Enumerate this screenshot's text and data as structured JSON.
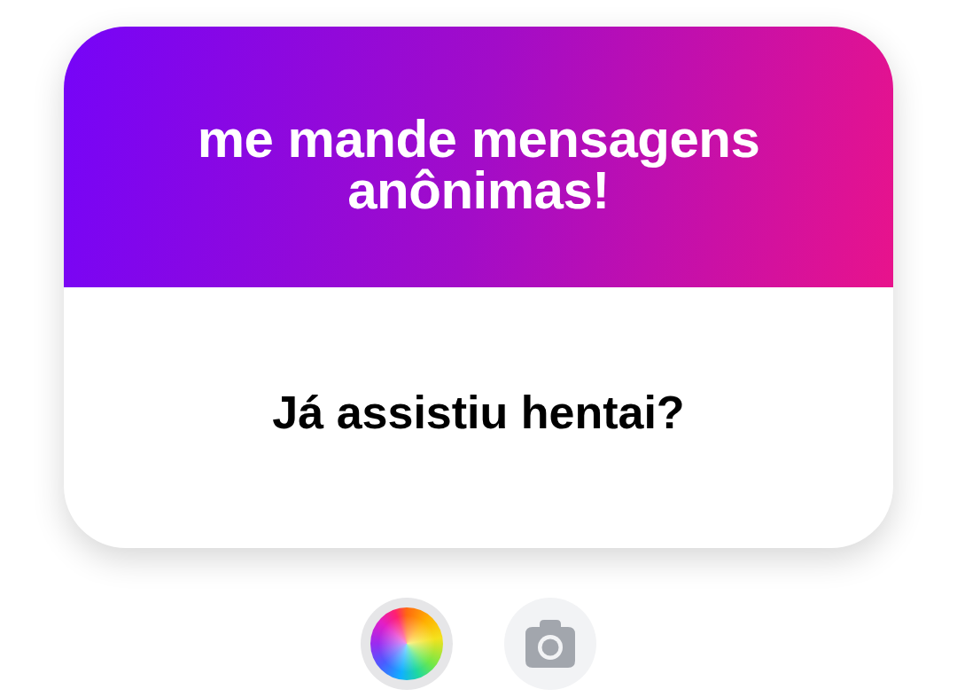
{
  "card": {
    "header": "me mande mensagens anônimas!",
    "question": "Já assistiu hentai?"
  },
  "options": [
    {
      "kind": "color_wheel",
      "selected": true
    },
    {
      "kind": "camera",
      "selected": false
    }
  ]
}
